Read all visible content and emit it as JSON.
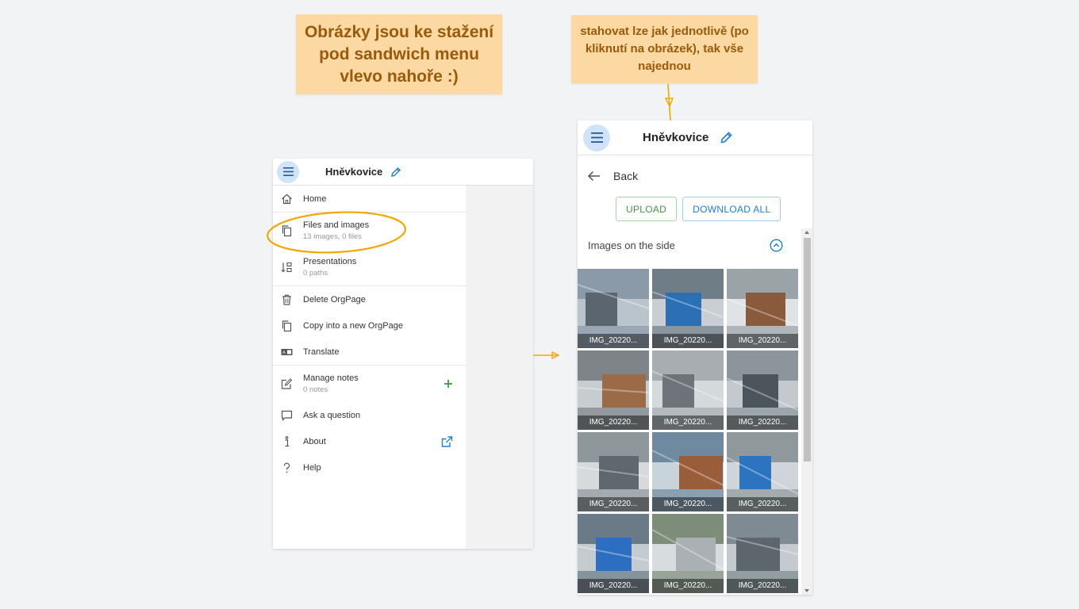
{
  "annotations": {
    "left_note": "Obrázky jsou ke stažení pod sandwich menu vlevo nahoře :)",
    "right_note": "stahovat lze jak jednotlivě (po kliknutí na obrázek), tak vše najednou"
  },
  "colors": {
    "accent": "#1e7fd0",
    "note_bg": "#fcd9a3",
    "note_text": "#9a5a0a",
    "highlight": "#f0a800",
    "add_green": "#3d9c3d"
  },
  "app": {
    "name": "Hněvkovice"
  },
  "menu": {
    "home": "Home",
    "files": {
      "label": "Files and images",
      "sub": "13 images, 0 files"
    },
    "presentations": {
      "label": "Presentations",
      "sub": "0 paths"
    },
    "delete": "Delete OrgPage",
    "copy": "Copy into a new OrgPage",
    "translate": "Translate",
    "notes": {
      "label": "Manage notes",
      "sub": "0 notes"
    },
    "ask": "Ask a question",
    "about": "About",
    "help": "Help"
  },
  "files_view": {
    "back_label": "Back",
    "upload_label": "UPLOAD",
    "download_all_label": "DOWNLOAD ALL",
    "section_title": "Images on the side",
    "images": [
      "IMG_20220...",
      "IMG_20220...",
      "IMG_20220...",
      "IMG_20220...",
      "IMG_20220...",
      "IMG_20220...",
      "IMG_20220...",
      "IMG_20220...",
      "IMG_20220...",
      "IMG_20220...",
      "IMG_20220...",
      "IMG_20220..."
    ]
  }
}
